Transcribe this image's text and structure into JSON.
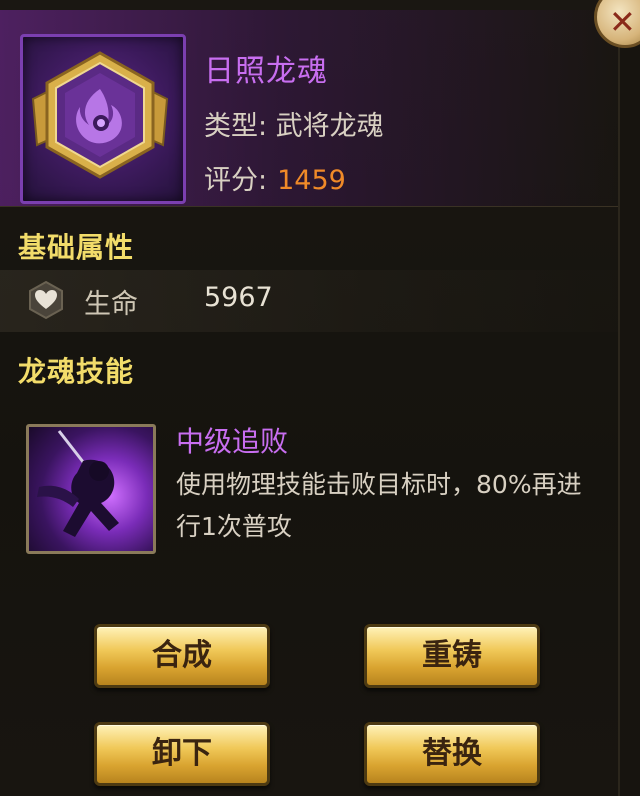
{
  "item": {
    "name": "日照龙魂",
    "type_text": "类型: 武将龙魂",
    "score_label": "评分:",
    "score_value": "1459"
  },
  "sections": {
    "base_attributes_title": "基础属性",
    "skill_title": "龙魂技能"
  },
  "attributes": [
    {
      "label": "生命",
      "value": "5967",
      "icon": "heart-icon"
    }
  ],
  "skill": {
    "name": "中级追败",
    "description": "使用物理技能击败目标时，80%再进行1次普攻"
  },
  "buttons": {
    "compose": "合成",
    "reforge": "重铸",
    "unequip": "卸下",
    "replace": "替换"
  },
  "colors": {
    "name_purple": "#c86ef0",
    "section_gold": "#f2dc6a",
    "score_orange": "#f08a28",
    "button_gold": "#f0c858"
  }
}
